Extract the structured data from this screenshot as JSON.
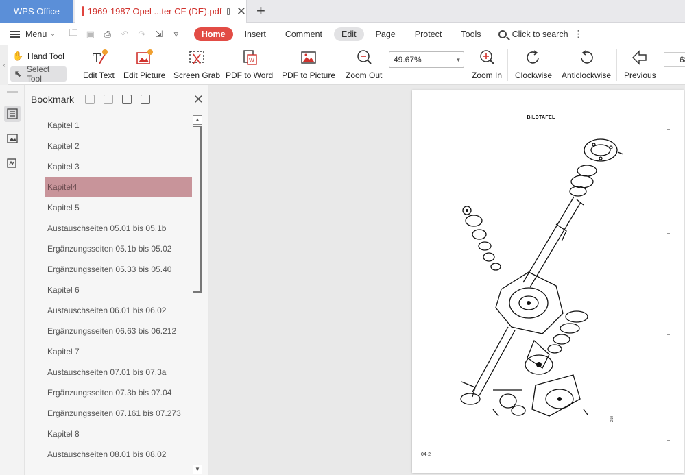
{
  "app": {
    "name": "WPS Office"
  },
  "document_tab": {
    "title": "1969-1987 Opel ...ter CF (DE).pdf"
  },
  "menubar": {
    "menu_label": "Menu",
    "tabs": [
      {
        "label": "Home",
        "state": "active"
      },
      {
        "label": "Insert"
      },
      {
        "label": "Comment"
      },
      {
        "label": "Edit",
        "state": "hovered"
      },
      {
        "label": "Page"
      },
      {
        "label": "Protect"
      },
      {
        "label": "Tools"
      }
    ],
    "search_label": "Click to search"
  },
  "ribbon": {
    "hand_tool": "Hand Tool",
    "select_tool": "Select Tool",
    "edit_text": "Edit Text",
    "edit_picture": "Edit Picture",
    "screen_grab": "Screen Grab",
    "pdf_to_word": "PDF to Word",
    "pdf_to_picture": "PDF to Picture",
    "zoom_out": "Zoom Out",
    "zoom_value": "49.67%",
    "zoom_in": "Zoom In",
    "clockwise": "Clockwise",
    "anticlockwise": "Anticlockwise",
    "previous": "Previous",
    "page_number": "68"
  },
  "bookmark_panel": {
    "title": "Bookmark",
    "items": [
      {
        "label": "Kapitel 1"
      },
      {
        "label": "Kapitel 2"
      },
      {
        "label": "Kapitel 3"
      },
      {
        "label": "Kapitel4",
        "selected": true
      },
      {
        "label": "Kapitel 5"
      },
      {
        "label": "Austauschseiten 05.01 bis 05.1b"
      },
      {
        "label": "Ergänzungsseiten 05.1b bis 05.02"
      },
      {
        "label": "Ergänzungsseiten 05.33 bis 05.40"
      },
      {
        "label": "Kapitel 6"
      },
      {
        "label": "Austauschseiten 06.01 bis 06.02"
      },
      {
        "label": "Ergänzungsseiten 06.63 bis 06.212"
      },
      {
        "label": "Kapitel 7"
      },
      {
        "label": "Austauschseiten 07.01 bis 07.3a"
      },
      {
        "label": "Ergänzungsseiten 07.3b bis 07.04"
      },
      {
        "label": "Ergänzungsseiten 07.161 bis 07.273"
      },
      {
        "label": "Kapitel 8"
      },
      {
        "label": "Austauschseiten 08.01 bis 08.02"
      }
    ]
  },
  "page": {
    "heading": "BILDTAFEL",
    "footer": "04-2",
    "side_mark": "219"
  },
  "colors": {
    "accent": "#e24c45",
    "app_tab": "#5b8fd8",
    "selected_bookmark": "#c8949a"
  }
}
